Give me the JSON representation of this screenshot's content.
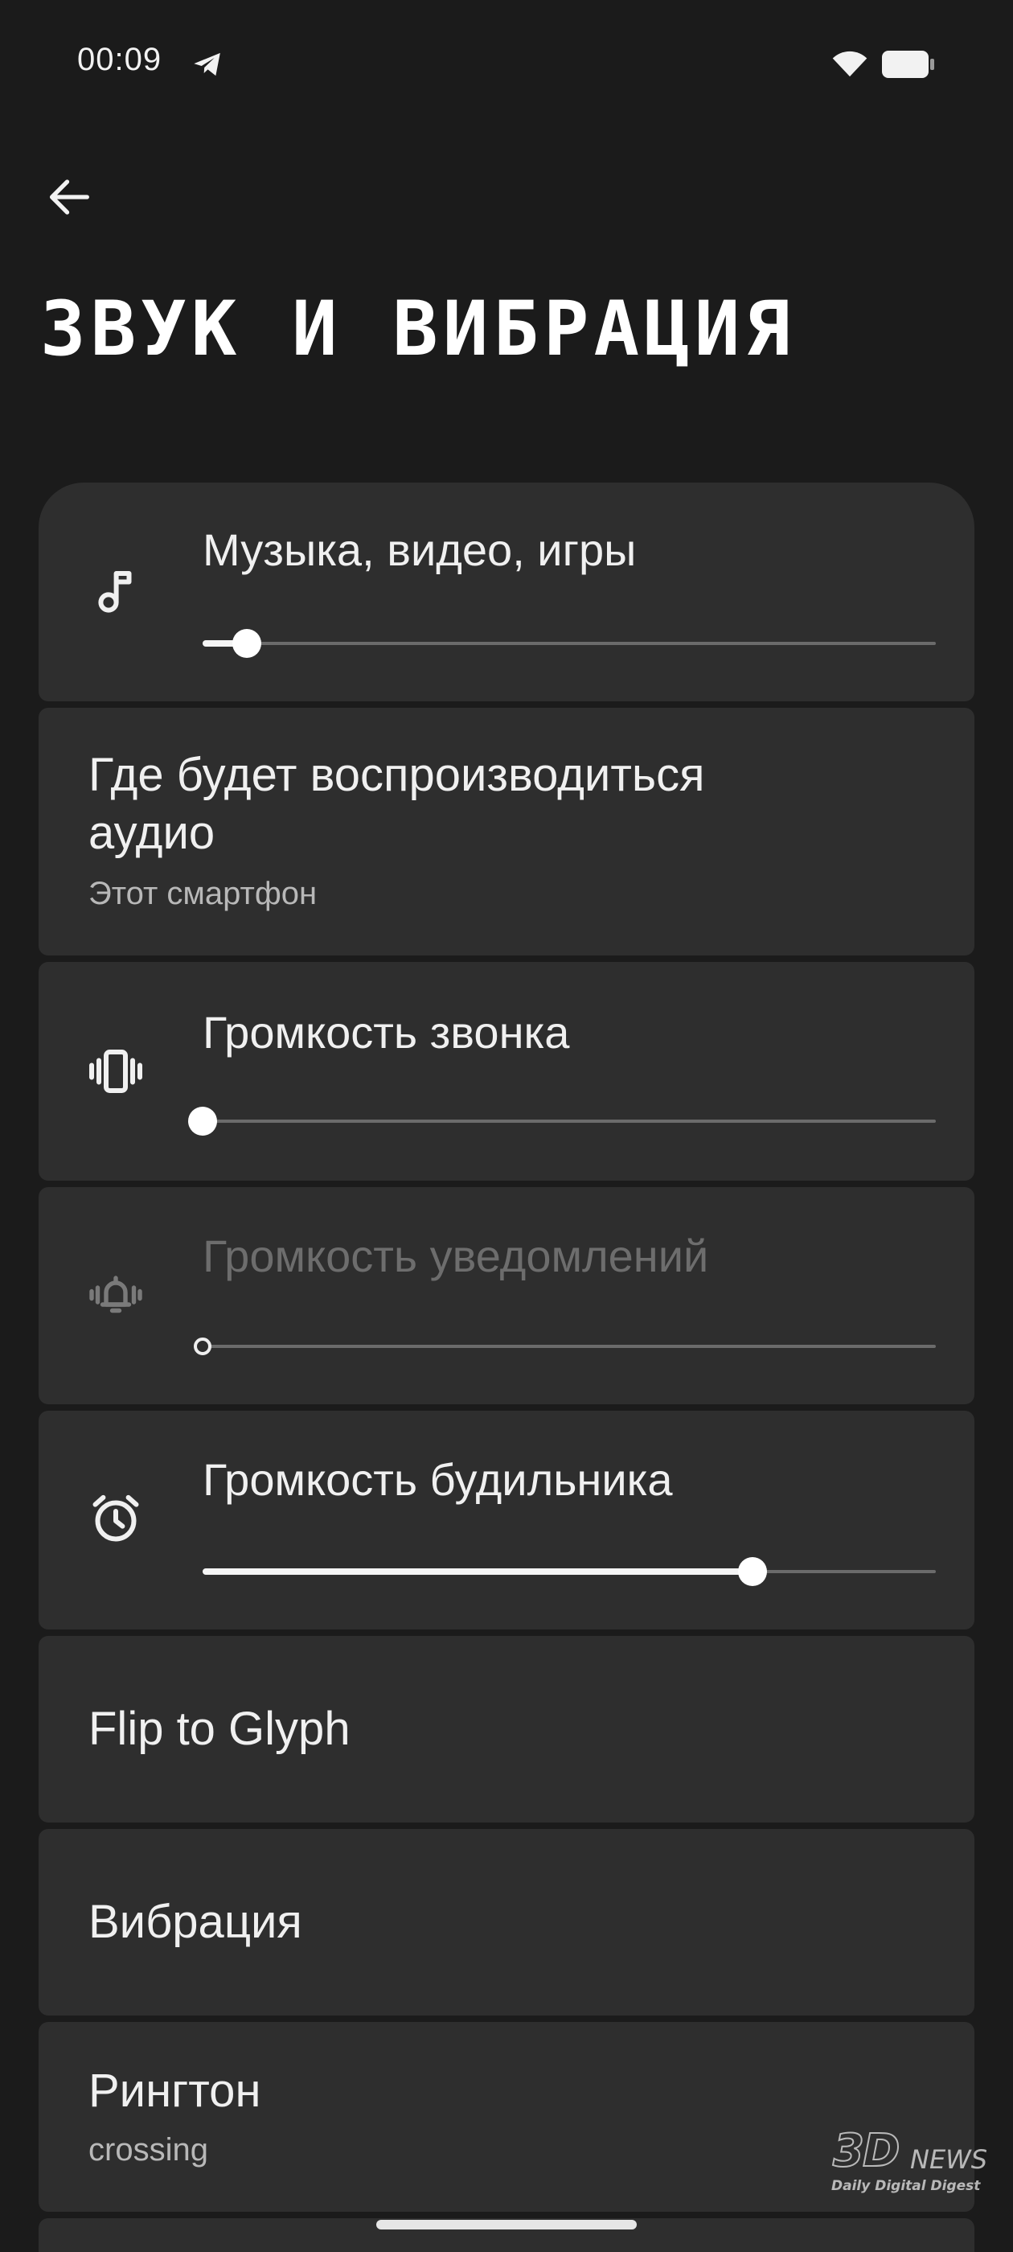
{
  "status_bar": {
    "time": "00:09",
    "notification_icon": "telegram-icon",
    "wifi_icon": "wifi-icon",
    "battery_icon": "battery-icon"
  },
  "header": {
    "back_icon": "back-arrow-icon",
    "title": "ЗВУК И ВИБРАЦИЯ"
  },
  "settings": {
    "media_volume": {
      "label": "Музыка, видео, игры",
      "icon": "music-note-icon",
      "value": 0.06
    },
    "audio_output": {
      "label": "Где будет воспроизводиться аудио",
      "value": "Этот смартфон"
    },
    "ring_volume": {
      "label": "Громкость звонка",
      "icon": "vibrate-icon",
      "value": 0.0
    },
    "notification_volume": {
      "label": "Громкость уведомлений",
      "icon": "notification-vibrate-icon",
      "value": 0.0,
      "disabled": true
    },
    "alarm_volume": {
      "label": "Громкость будильника",
      "icon": "alarm-clock-icon",
      "value": 0.75
    },
    "flip_to_glyph": {
      "label": "Flip to Glyph"
    },
    "vibration": {
      "label": "Вибрация"
    },
    "ringtone": {
      "label": "Рингтон",
      "value": "crossing"
    }
  },
  "watermark": {
    "logo": "3D",
    "news": "NEWS",
    "tagline": "Daily Digital Digest"
  },
  "colors": {
    "background": "#1b1b1b",
    "card": "#2e2e2e",
    "text_primary": "#f0f0f0",
    "text_disabled": "#6d6d6d"
  }
}
